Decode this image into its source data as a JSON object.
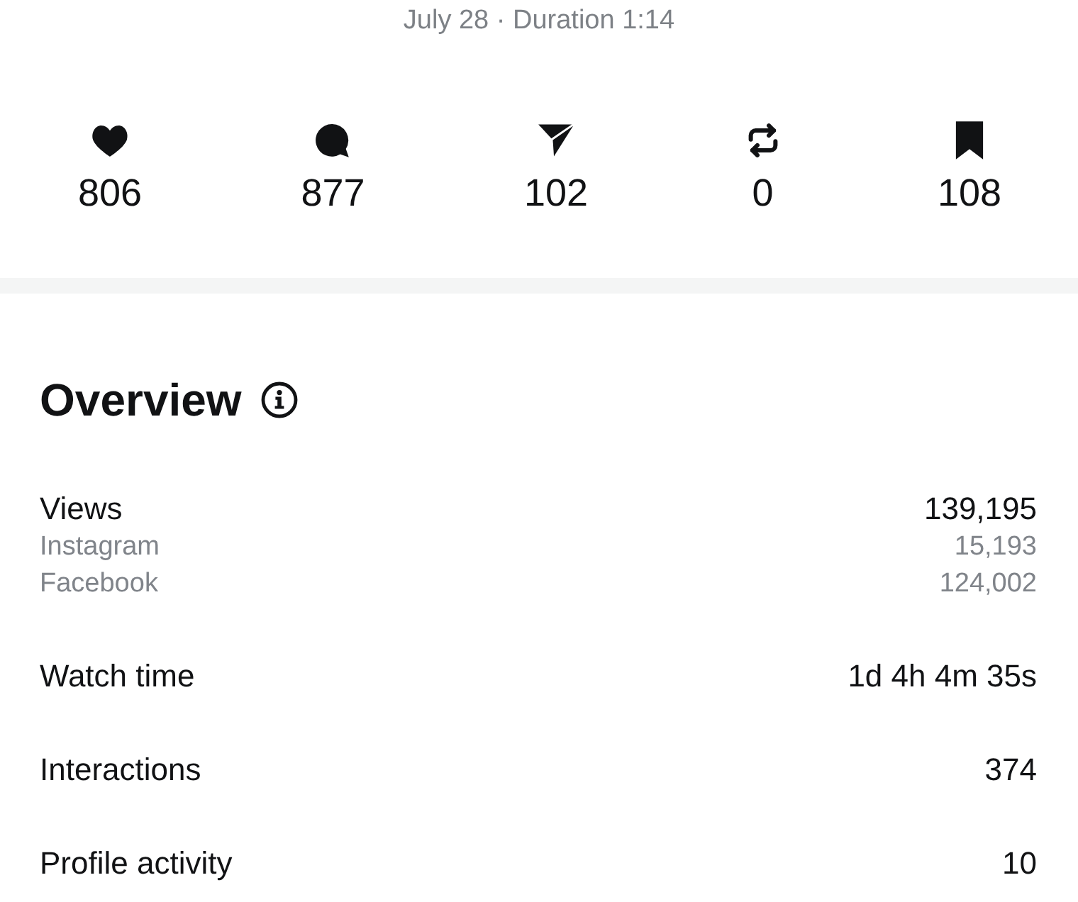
{
  "header": {
    "subtitle": "July 28 · Duration 1:14"
  },
  "stats": [
    {
      "kind": "likes",
      "value": "806"
    },
    {
      "kind": "comments",
      "value": "877"
    },
    {
      "kind": "shares",
      "value": "102"
    },
    {
      "kind": "reposts",
      "value": "0"
    },
    {
      "kind": "saves",
      "value": "108"
    }
  ],
  "overview": {
    "title": "Overview",
    "metrics": [
      {
        "label": "Views",
        "value": "139,195",
        "breakdown": [
          {
            "label": "Instagram",
            "value": "15,193"
          },
          {
            "label": "Facebook",
            "value": "124,002"
          }
        ]
      },
      {
        "label": "Watch time",
        "value": "1d 4h 4m 35s"
      },
      {
        "label": "Interactions",
        "value": "374"
      },
      {
        "label": "Profile activity",
        "value": "10"
      }
    ]
  }
}
